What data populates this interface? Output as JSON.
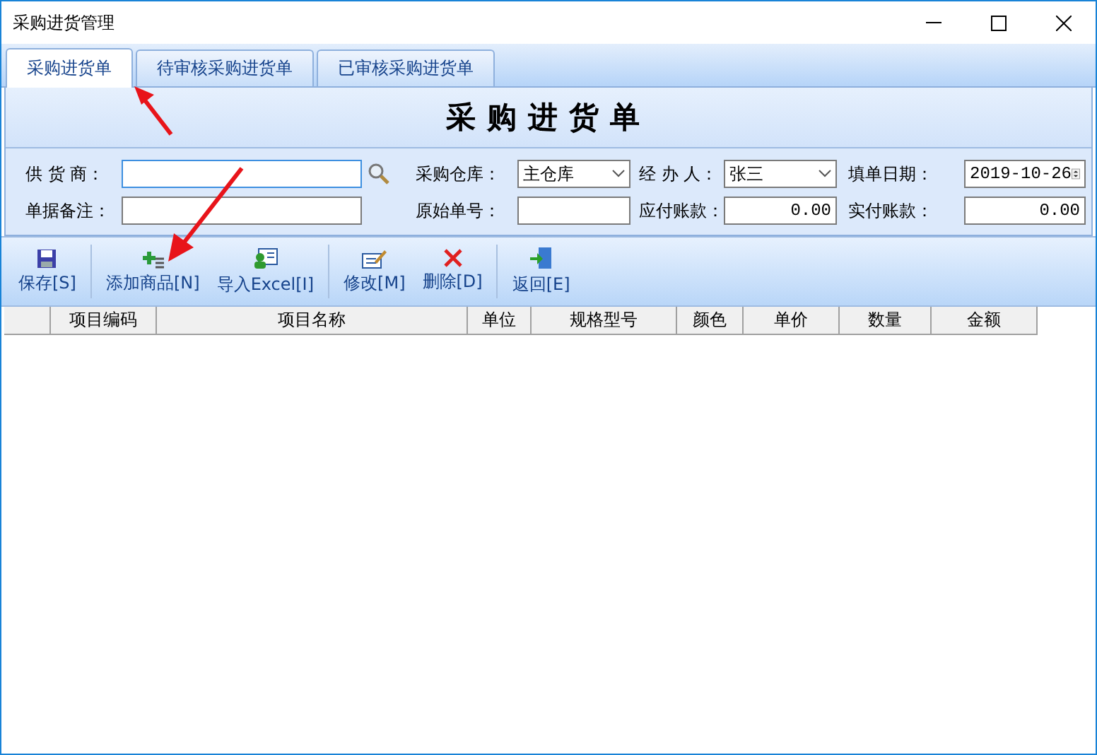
{
  "window": {
    "title": "采购进货管理"
  },
  "tabs": [
    {
      "label": "采购进货单",
      "selected": true
    },
    {
      "label": "待审核采购进货单",
      "selected": false
    },
    {
      "label": "已审核采购进货单",
      "selected": false
    }
  ],
  "form_title": "采购进货单",
  "fields": {
    "supplier": {
      "label": "供 货 商："
    },
    "warehouse": {
      "label": "采购仓库：",
      "value": "主仓库"
    },
    "handler": {
      "label": "经 办 人：",
      "value": "张三"
    },
    "date": {
      "label": "填单日期：",
      "value": "2019-10-26"
    },
    "remark": {
      "label": "单据备注："
    },
    "original_no": {
      "label": "原始单号："
    },
    "payable": {
      "label": "应付账款：",
      "value": "0.00"
    },
    "paid": {
      "label": "实付账款：",
      "value": "0.00"
    }
  },
  "toolbar": [
    {
      "kind": "save",
      "label": "保存[S]"
    },
    {
      "kind": "add",
      "label": "添加商品[N]"
    },
    {
      "kind": "excel",
      "label": "导入Excel[I]"
    },
    {
      "kind": "edit",
      "label": "修改[M]"
    },
    {
      "kind": "delete",
      "label": "删除[D]"
    },
    {
      "kind": "back",
      "label": "返回[E]"
    }
  ],
  "table": {
    "columns": [
      "项目编码",
      "项目名称",
      "单位",
      "规格型号",
      "颜色",
      "单价",
      "数量",
      "金额"
    ]
  }
}
